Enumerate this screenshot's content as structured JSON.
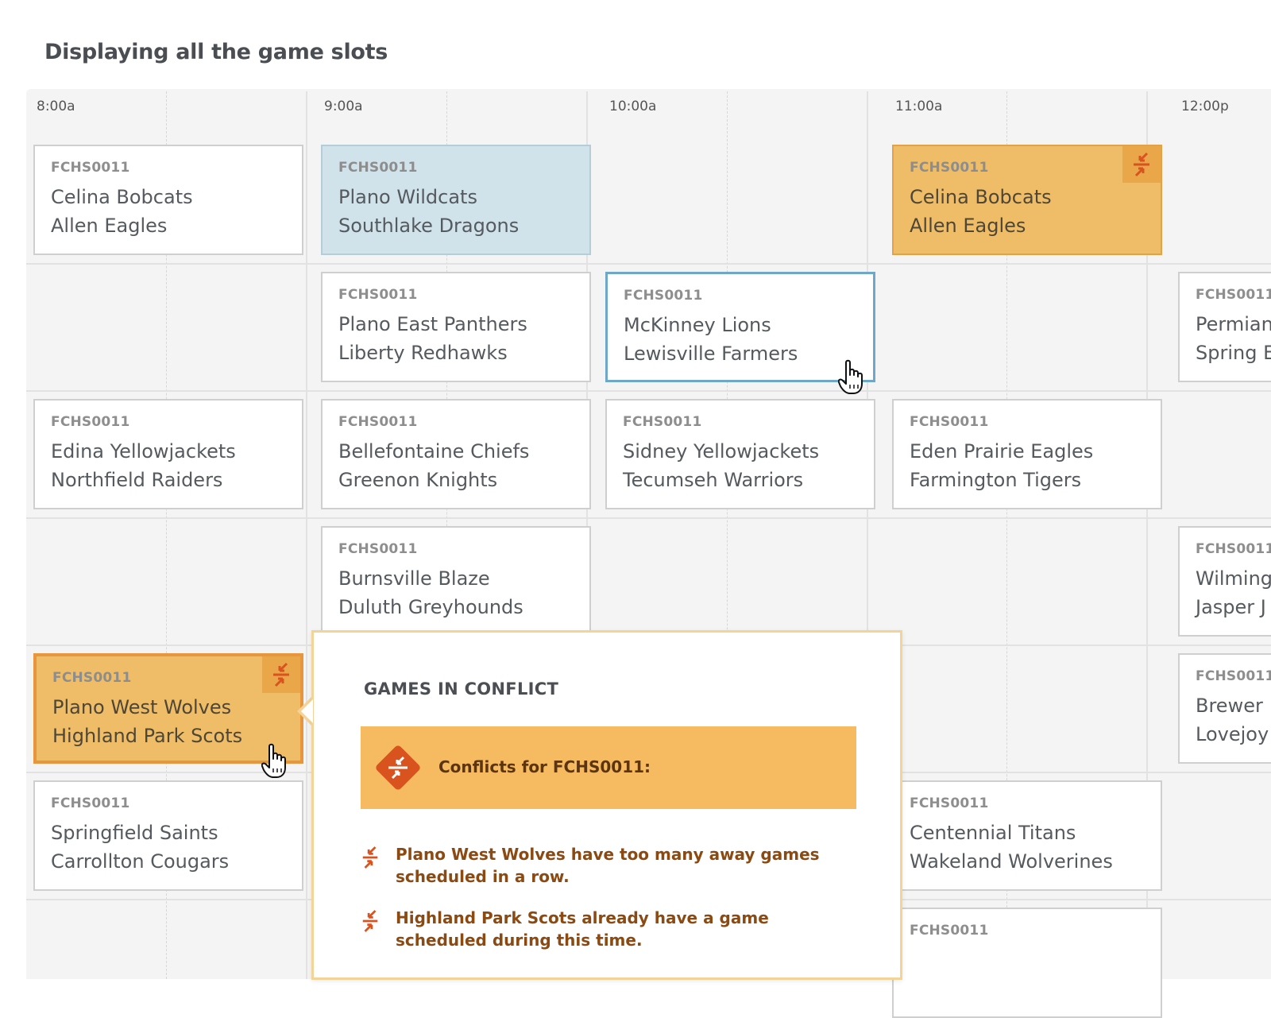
{
  "page": {
    "heading": "Displaying all the game slots"
  },
  "timeline": {
    "hours": [
      "8:00a",
      "9:00a",
      "10:00a",
      "11:00a",
      "12:00p"
    ]
  },
  "cards": {
    "c1": {
      "code": "FCHS0011",
      "team1": "Celina Bobcats",
      "team2": "Allen Eagles"
    },
    "c2": {
      "code": "FCHS0011",
      "team1": "Plano Wildcats",
      "team2": "Southlake Dragons"
    },
    "c3": {
      "code": "FCHS0011",
      "team1": "Celina Bobcats",
      "team2": "Allen Eagles"
    },
    "c4": {
      "code": "FCHS0011",
      "team1": "Plano East Panthers",
      "team2": "Liberty Redhawks"
    },
    "c5": {
      "code": "FCHS0011",
      "team1": "McKinney Lions",
      "team2": "Lewisville Farmers"
    },
    "c6": {
      "code": "FCHS0011",
      "team1": "Permian",
      "team2": "Spring E"
    },
    "c7": {
      "code": "FCHS0011",
      "team1": "Edina Yellowjackets",
      "team2": "Northfield Raiders"
    },
    "c8": {
      "code": "FCHS0011",
      "team1": "Bellefontaine Chiefs",
      "team2": "Greenon Knights"
    },
    "c9": {
      "code": "FCHS0011",
      "team1": "Sidney Yellowjackets",
      "team2": "Tecumseh Warriors"
    },
    "c10": {
      "code": "FCHS0011",
      "team1": "Eden Prairie Eagles",
      "team2": "Farmington Tigers"
    },
    "c11": {
      "code": "FCHS0011",
      "team1": "Burnsville Blaze",
      "team2": "Duluth Greyhounds"
    },
    "c12": {
      "code": "FCHS0011",
      "team1": "Wilming",
      "team2": "Jasper J"
    },
    "c13": {
      "code": "FCHS0011",
      "team1": "Plano West Wolves",
      "team2": "Highland Park Scots"
    },
    "c14": {
      "code": "FCHS0011",
      "team1": "Brewer",
      "team2": "Lovejoy"
    },
    "c15": {
      "code": "FCHS0011",
      "team1": "Springfield Saints",
      "team2": "Carrollton Cougars"
    },
    "c16": {
      "code": "FCHS0011",
      "team1": "Centennial Titans",
      "team2": "Wakeland Wolverines"
    },
    "c17": {
      "code": "FCHS0011",
      "team1": "",
      "team2": ""
    }
  },
  "conflict_popover": {
    "title": "GAMES IN CONFLICT",
    "banner": "Conflicts for FCHS0011:",
    "items": [
      "Plano West Wolves have too many away games scheduled in a row.",
      "Highland Park Scots already have a game scheduled during this time."
    ]
  },
  "colors": {
    "conflict_card": "#efbd67",
    "conflict_banner": "#f6bb60",
    "conflict_icon": "#d9531e",
    "highlight_card": "#d0e2ea",
    "selected_border": "#6fa7c8"
  },
  "icons": {
    "conflict": "conflict-arrows-icon",
    "cursor": "hand-pointer-cursor"
  }
}
